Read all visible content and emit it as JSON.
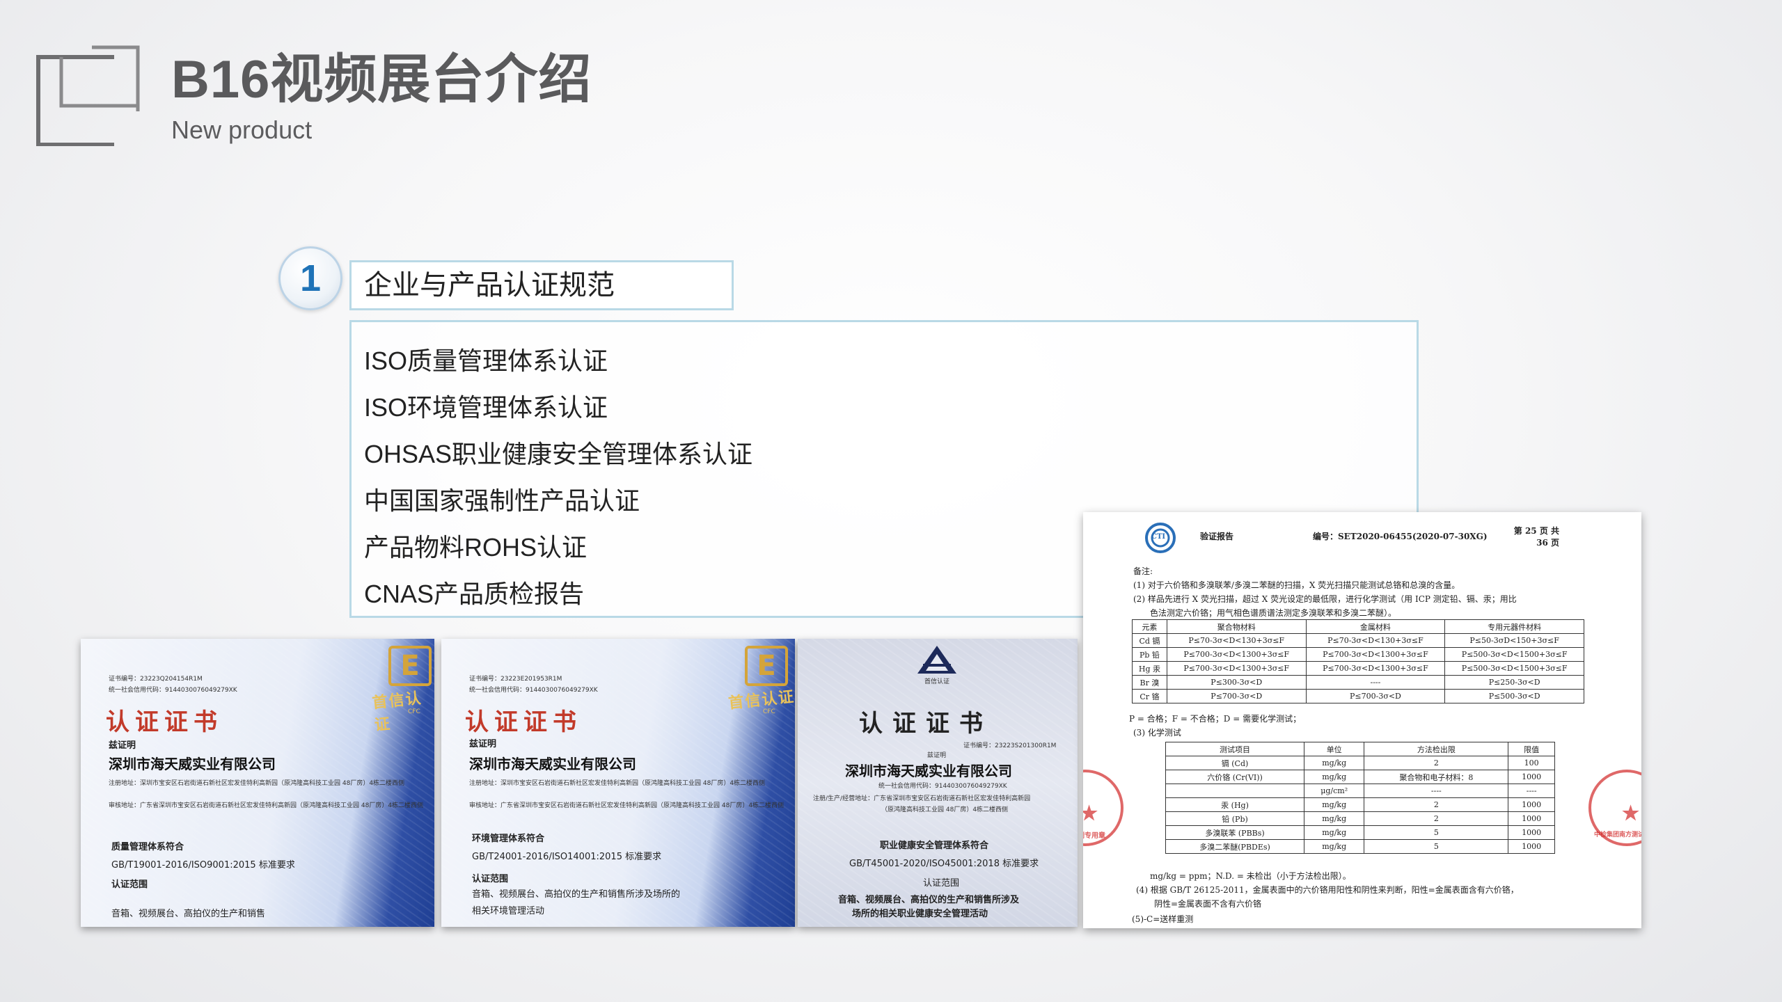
{
  "header": {
    "title": "B16视频展台介绍",
    "subtitle": "New product"
  },
  "section": {
    "number": "1",
    "heading": "企业与产品认证规范",
    "items": [
      "ISO质量管理体系认证",
      "ISO环境管理体系认证",
      "OHSAS职业健康安全管理体系认证",
      "中国国家强制性产品认证",
      "产品物料ROHS认证",
      "CNAS产品质检报告"
    ]
  },
  "certificates": [
    {
      "cert_no": "证书编号：23223Q204154R1M",
      "credit_code": "统一社会信用代码：914403007604927​9XK",
      "heading": "认证证书",
      "certify": "兹证明",
      "company": "深圳市海天威实业有限公司",
      "reg_addr": "注册地址：深圳市宝安区石岩街道石新社区宏发佳特利高新园（原鸿隆高科技工业园 48厂房）4栋二楼西侧",
      "audit_addr": "审核地址：广东省深圳市宝安区石岩街道石新社区宏发佳特利高新园（原鸿隆高科技工业园 48厂房）4栋二楼西侧",
      "system": "质量管理体系符合",
      "standard": "GB/T19001-2016/ISO9001:2015 标准要求",
      "scope_label": "认证范围",
      "scope": "音箱、视频展台、高拍仪的生产和销售",
      "emblem_text": "首信认证",
      "emblem_sub": "CFC"
    },
    {
      "cert_no": "证书编号：23223E201953R1M",
      "credit_code": "统一社会信用代码：914403007604927​9XK",
      "heading": "认证证书",
      "certify": "兹证明",
      "company": "深圳市海天威实业有限公司",
      "reg_addr": "注册地址：深圳市宝安区石岩街道石新社区宏发佳特利高新园（原鸿隆高科技工业园 48厂房）4栋二楼西侧",
      "audit_addr": "审核地址：广东省深圳市宝安区石岩街道石新社区宏发佳特利高新园（原鸿隆高科技工业园 48厂房）4栋二楼西侧",
      "system": "环境管理体系符合",
      "standard": "GB/T24001-2016/ISO14001:2015 标准要求",
      "scope_label": "认证范围",
      "scope": "音箱、视频展台、高拍仪的生产和销售所涉及场所的",
      "scope2": "相关环境管理活动",
      "emblem_text": "首信认证",
      "emblem_sub": "CFC"
    },
    {
      "logo_text": "首信认证",
      "heading": "认证证书",
      "cert_no": "证书编号：23223S201300R1M",
      "certify": "兹证明",
      "company": "深圳市海天威实业有限公司",
      "credit_code": "统一社会信用代码：914403007604927​9XK",
      "reg_addr": "注册/生产/经营地址：广东省深圳市宝安区石岩街道石新社区宏发佳特利高新园",
      "reg_addr2": "（原鸿隆高科技工业园 48厂房）4栋二楼西侧",
      "system": "职业健康安全管理体系符合",
      "standard": "GB/T45001-2020/ISO45001:2018 标准要求",
      "scope_label": "认证范围",
      "scope": "音箱、视频展台、高拍仪的生产和销售所涉及",
      "scope2": "场所的相关职业健康安全管理活动"
    }
  ],
  "report": {
    "logo": "CTI",
    "label": "验证报告",
    "report_no": "编号：SET2020-06455(2020-07-30XG)",
    "page": "第 25 页 共 36 页",
    "notes_title": "备注:",
    "note1": "(1) 对于六价铬和多溴联苯/多溴二苯醚的扫描，X 荧光扫描只能测试总铬和总溴的含量。",
    "note2": "(2) 样品先进行 X 荧光扫描，超过 X 荧光设定的最低限，进行化学测试（用 ICP 测定铅、镉、汞；用比",
    "note2b": "色法测定六价铬；用气相色谱质谱法测定多溴联苯和多溴二苯醚）。",
    "table1": {
      "header": [
        "元素",
        "聚合物材料",
        "金属材料",
        "专用元器件材料"
      ],
      "rows": [
        [
          "Cd 镉",
          "P≤70-3σ<D<130+3σ≤F",
          "P≤70-3σ<D<130+3σ≤F",
          "P≤50-3σD<150+3σ≤F"
        ],
        [
          "Pb 铅",
          "P≤700-3σ<D<1300+3σ≤F",
          "P≤700-3σ<D<1300+3σ≤F",
          "P≤500-3σ<D<1500+3σ≤F"
        ],
        [
          "Hg 汞",
          "P≤700-3σ<D<1300+3σ≤F",
          "P≤700-3σ<D<1300+3σ≤F",
          "P≤500-3σ<D<1500+3σ≤F"
        ],
        [
          "Br 溴",
          "P≤300-3σ<D",
          "----",
          "P≤250-3σ<D"
        ],
        [
          "Cr 铬",
          "P≤700-3σ<D",
          "P≤700-3σ<D",
          "P≤500-3σ<D"
        ]
      ]
    },
    "legend": "P = 合格；F = 不合格；D = 需要化学测试；",
    "note3": "(3) 化学测试",
    "table2": {
      "header": [
        "测试项目",
        "单位",
        "方法检出限",
        "限值"
      ],
      "rows": [
        [
          "镉 (Cd)",
          "mg/kg",
          "2",
          "100"
        ],
        [
          "六价铬 (Cr(VI))",
          "mg/kg",
          "聚合物和电子材料：8",
          "1000"
        ],
        [
          "",
          "μg/cm²",
          "----",
          "----"
        ],
        [
          "汞 (Hg)",
          "mg/kg",
          "2",
          "1000"
        ],
        [
          "铅 (Pb)",
          "mg/kg",
          "2",
          "1000"
        ],
        [
          "多溴联苯 (PBBs)",
          "mg/kg",
          "5",
          "1000"
        ],
        [
          "多溴二苯醚(PBDEs)",
          "mg/kg",
          "5",
          "1000"
        ]
      ]
    },
    "unit_note": "mg/kg = ppm；N.D. = 未检出（小于方法检出限）。",
    "note4": "(4) 根据 GB/T 26125-2011，金属表面中的六价铬用阳性和阴性来判断，阳性=金属表面含有六价铬，",
    "note4b": "阴性=金属表面不含有六价铬",
    "note5": "(5)-C=送样重测",
    "stamp_left": "检验检测专用章",
    "stamp_right": "中检集团南方测试检验检测"
  }
}
